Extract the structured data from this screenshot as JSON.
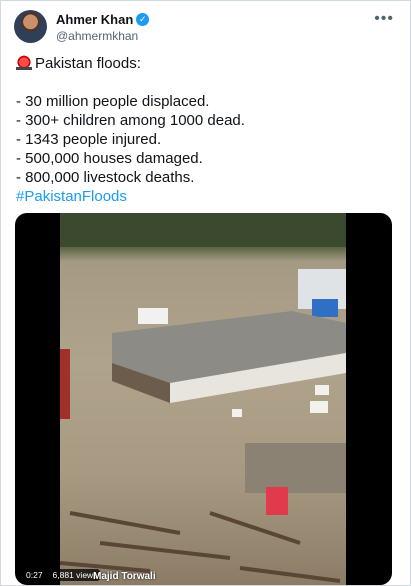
{
  "author": {
    "name": "Ahmer Khan",
    "handle": "@ahmermkhan",
    "verified_icon": "verified-badge-icon"
  },
  "tweet": {
    "lines": [
      "Pakistan floods:",
      "- 30 million people displaced.",
      "- 300+ children among 1000 dead.",
      "- 1343 people injured.",
      "- 500,000 houses damaged.",
      "- 800,000 livestock deaths."
    ],
    "hashtag": "#PakistanFloods"
  },
  "video": {
    "time": "0:27",
    "views": "6,881 views",
    "watermark": "Majid Torwali"
  },
  "colors": {
    "accent": "#1d9bf0",
    "text": "#0f1419",
    "muted": "#536471"
  }
}
